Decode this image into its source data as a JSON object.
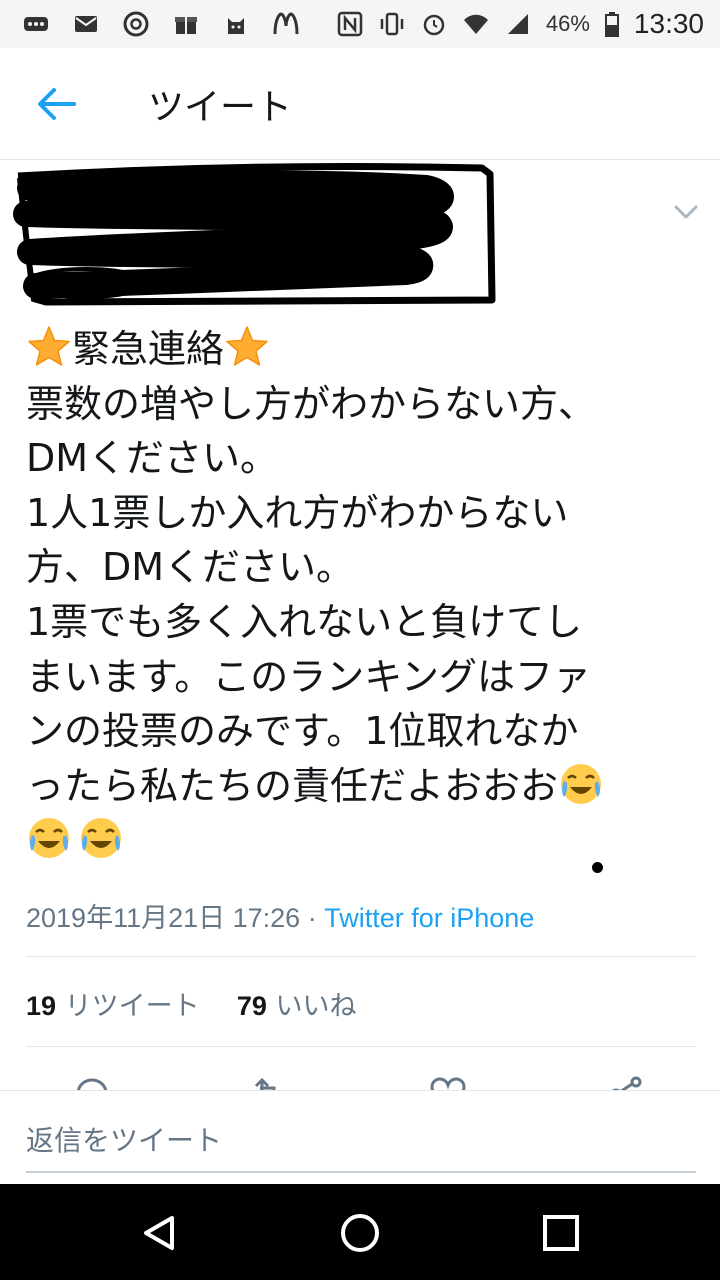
{
  "status_bar": {
    "icons": [
      "more-icon",
      "mail-icon",
      "chrome-icon",
      "gift-icon",
      "cat-icon",
      "mcdonalds-icon",
      "nfc-icon",
      "vibrate-icon",
      "alarm-icon",
      "wifi-icon",
      "signal-icon",
      "battery-icon"
    ],
    "battery": "46%",
    "time": "13:30"
  },
  "header": {
    "back_icon": "arrow-left-icon",
    "title": "ツイート"
  },
  "tweet": {
    "redacted_profile": "black-scribble",
    "menu_icon": "chevron-down-icon",
    "lines": [
      {
        "pre": "",
        "text": "緊急連絡",
        "pre_emoji": "star",
        "post_emoji": "star"
      },
      {
        "text": "票数の増やし方がわからない方、"
      },
      {
        "text": "DMください。"
      },
      {
        "text": "1人1票しか入れ方がわからない"
      },
      {
        "text": "方、DMください。"
      },
      {
        "text": "1票でも多く入れないと負けてし"
      },
      {
        "text": "まいます。このランキングはファ"
      },
      {
        "text": "ンの投票のみです。1位取れなか"
      },
      {
        "text": "ったら私たちの責任だよおおお",
        "post_emoji": "joy"
      },
      {
        "text": "",
        "emojis": [
          "joy",
          "joy"
        ]
      }
    ],
    "timestamp": "2019年11月21日 17:26",
    "separator": " · ",
    "source": "Twitter for iPhone",
    "retweets": {
      "count": "19",
      "label": "リツイート"
    },
    "likes": {
      "count": "79",
      "label": "いいね"
    }
  },
  "action_icons": [
    "reply-icon",
    "retweet-icon",
    "like-icon",
    "share-icon"
  ],
  "reply": {
    "placeholder": "返信をツイート"
  },
  "nav": {
    "icons": [
      "back-triangle-icon",
      "home-circle-icon",
      "recents-square-icon"
    ]
  },
  "colors": {
    "accent": "#1da1f2",
    "muted": "#657786",
    "text": "#14171a",
    "divider": "#e1e8ed"
  }
}
